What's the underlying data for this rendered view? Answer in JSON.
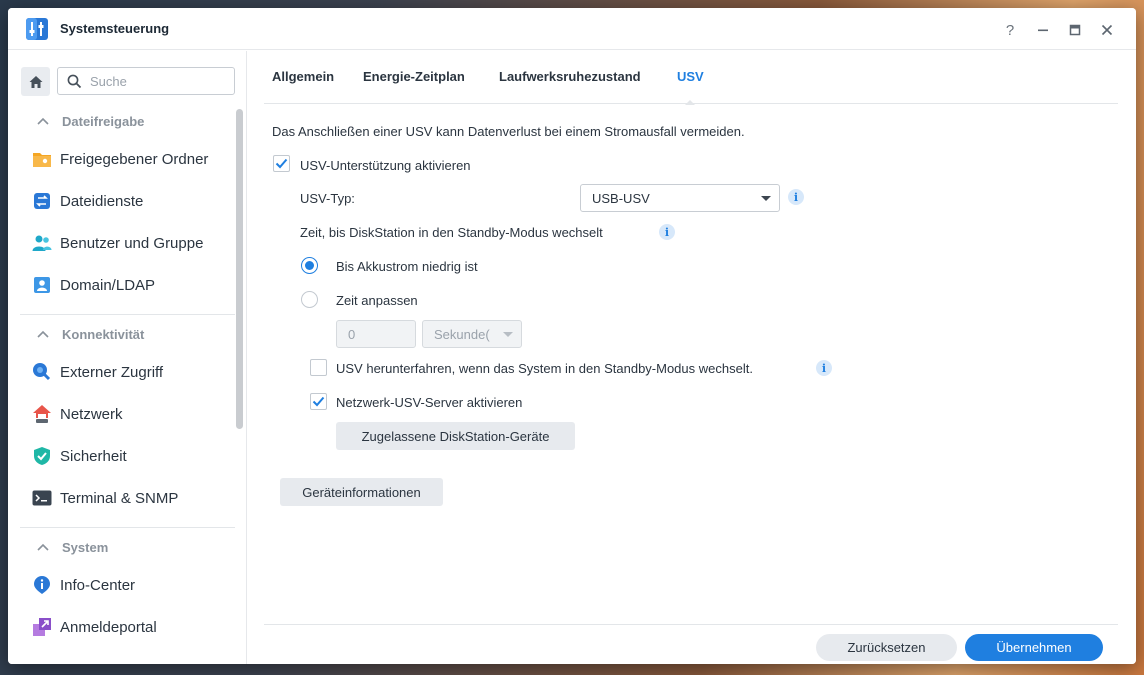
{
  "window": {
    "title": "Systemsteuerung"
  },
  "search": {
    "placeholder": "Suche"
  },
  "sidebar": {
    "sections": [
      {
        "label": "Dateifreigabe",
        "items": [
          {
            "label": "Freigegebener Ordner",
            "icon": "shared-folder-icon"
          },
          {
            "label": "Dateidienste",
            "icon": "file-services-icon"
          },
          {
            "label": "Benutzer und Gruppe",
            "icon": "users-icon"
          },
          {
            "label": "Domain/LDAP",
            "icon": "domain-icon"
          }
        ]
      },
      {
        "label": "Konnektivität",
        "items": [
          {
            "label": "Externer Zugriff",
            "icon": "external-access-icon"
          },
          {
            "label": "Netzwerk",
            "icon": "network-icon"
          },
          {
            "label": "Sicherheit",
            "icon": "shield-icon"
          },
          {
            "label": "Terminal & SNMP",
            "icon": "terminal-icon"
          }
        ]
      },
      {
        "label": "System",
        "items": [
          {
            "label": "Info-Center",
            "icon": "info-icon"
          },
          {
            "label": "Anmeldeportal",
            "icon": "login-portal-icon"
          }
        ]
      }
    ]
  },
  "tabs": [
    {
      "label": "Allgemein"
    },
    {
      "label": "Energie-Zeitplan"
    },
    {
      "label": "Laufwerksruhezustand"
    },
    {
      "label": "USV",
      "active": true
    }
  ],
  "ups": {
    "description": "Das Anschließen einer USV kann Datenverlust bei einem Stromausfall vermeiden.",
    "enable_label": "USV-Unterstützung aktivieren",
    "enable_checked": true,
    "type_label": "USV-Typ:",
    "type_value": "USB-USV",
    "standby_time_label": "Zeit, bis DiskStation in den Standby-Modus wechselt",
    "option_low_battery": "Bis Akkustrom niedrig ist",
    "option_custom": "Zeit anpassen",
    "selected_option": "low_battery",
    "time_value": "0",
    "time_unit": "Sekunde(",
    "shutdown_label": "USV herunterfahren, wenn das System in den Standby-Modus wechselt.",
    "shutdown_checked": false,
    "network_server_label": "Netzwerk-USV-Server aktivieren",
    "network_server_checked": true,
    "allowed_devices_button": "Zugelassene DiskStation-Geräte",
    "device_info_button": "Geräteinformationen"
  },
  "footer": {
    "reset_label": "Zurücksetzen",
    "apply_label": "Übernehmen"
  },
  "colors": {
    "accent": "#1f7fe0",
    "button_gray": "#e7eaee"
  }
}
